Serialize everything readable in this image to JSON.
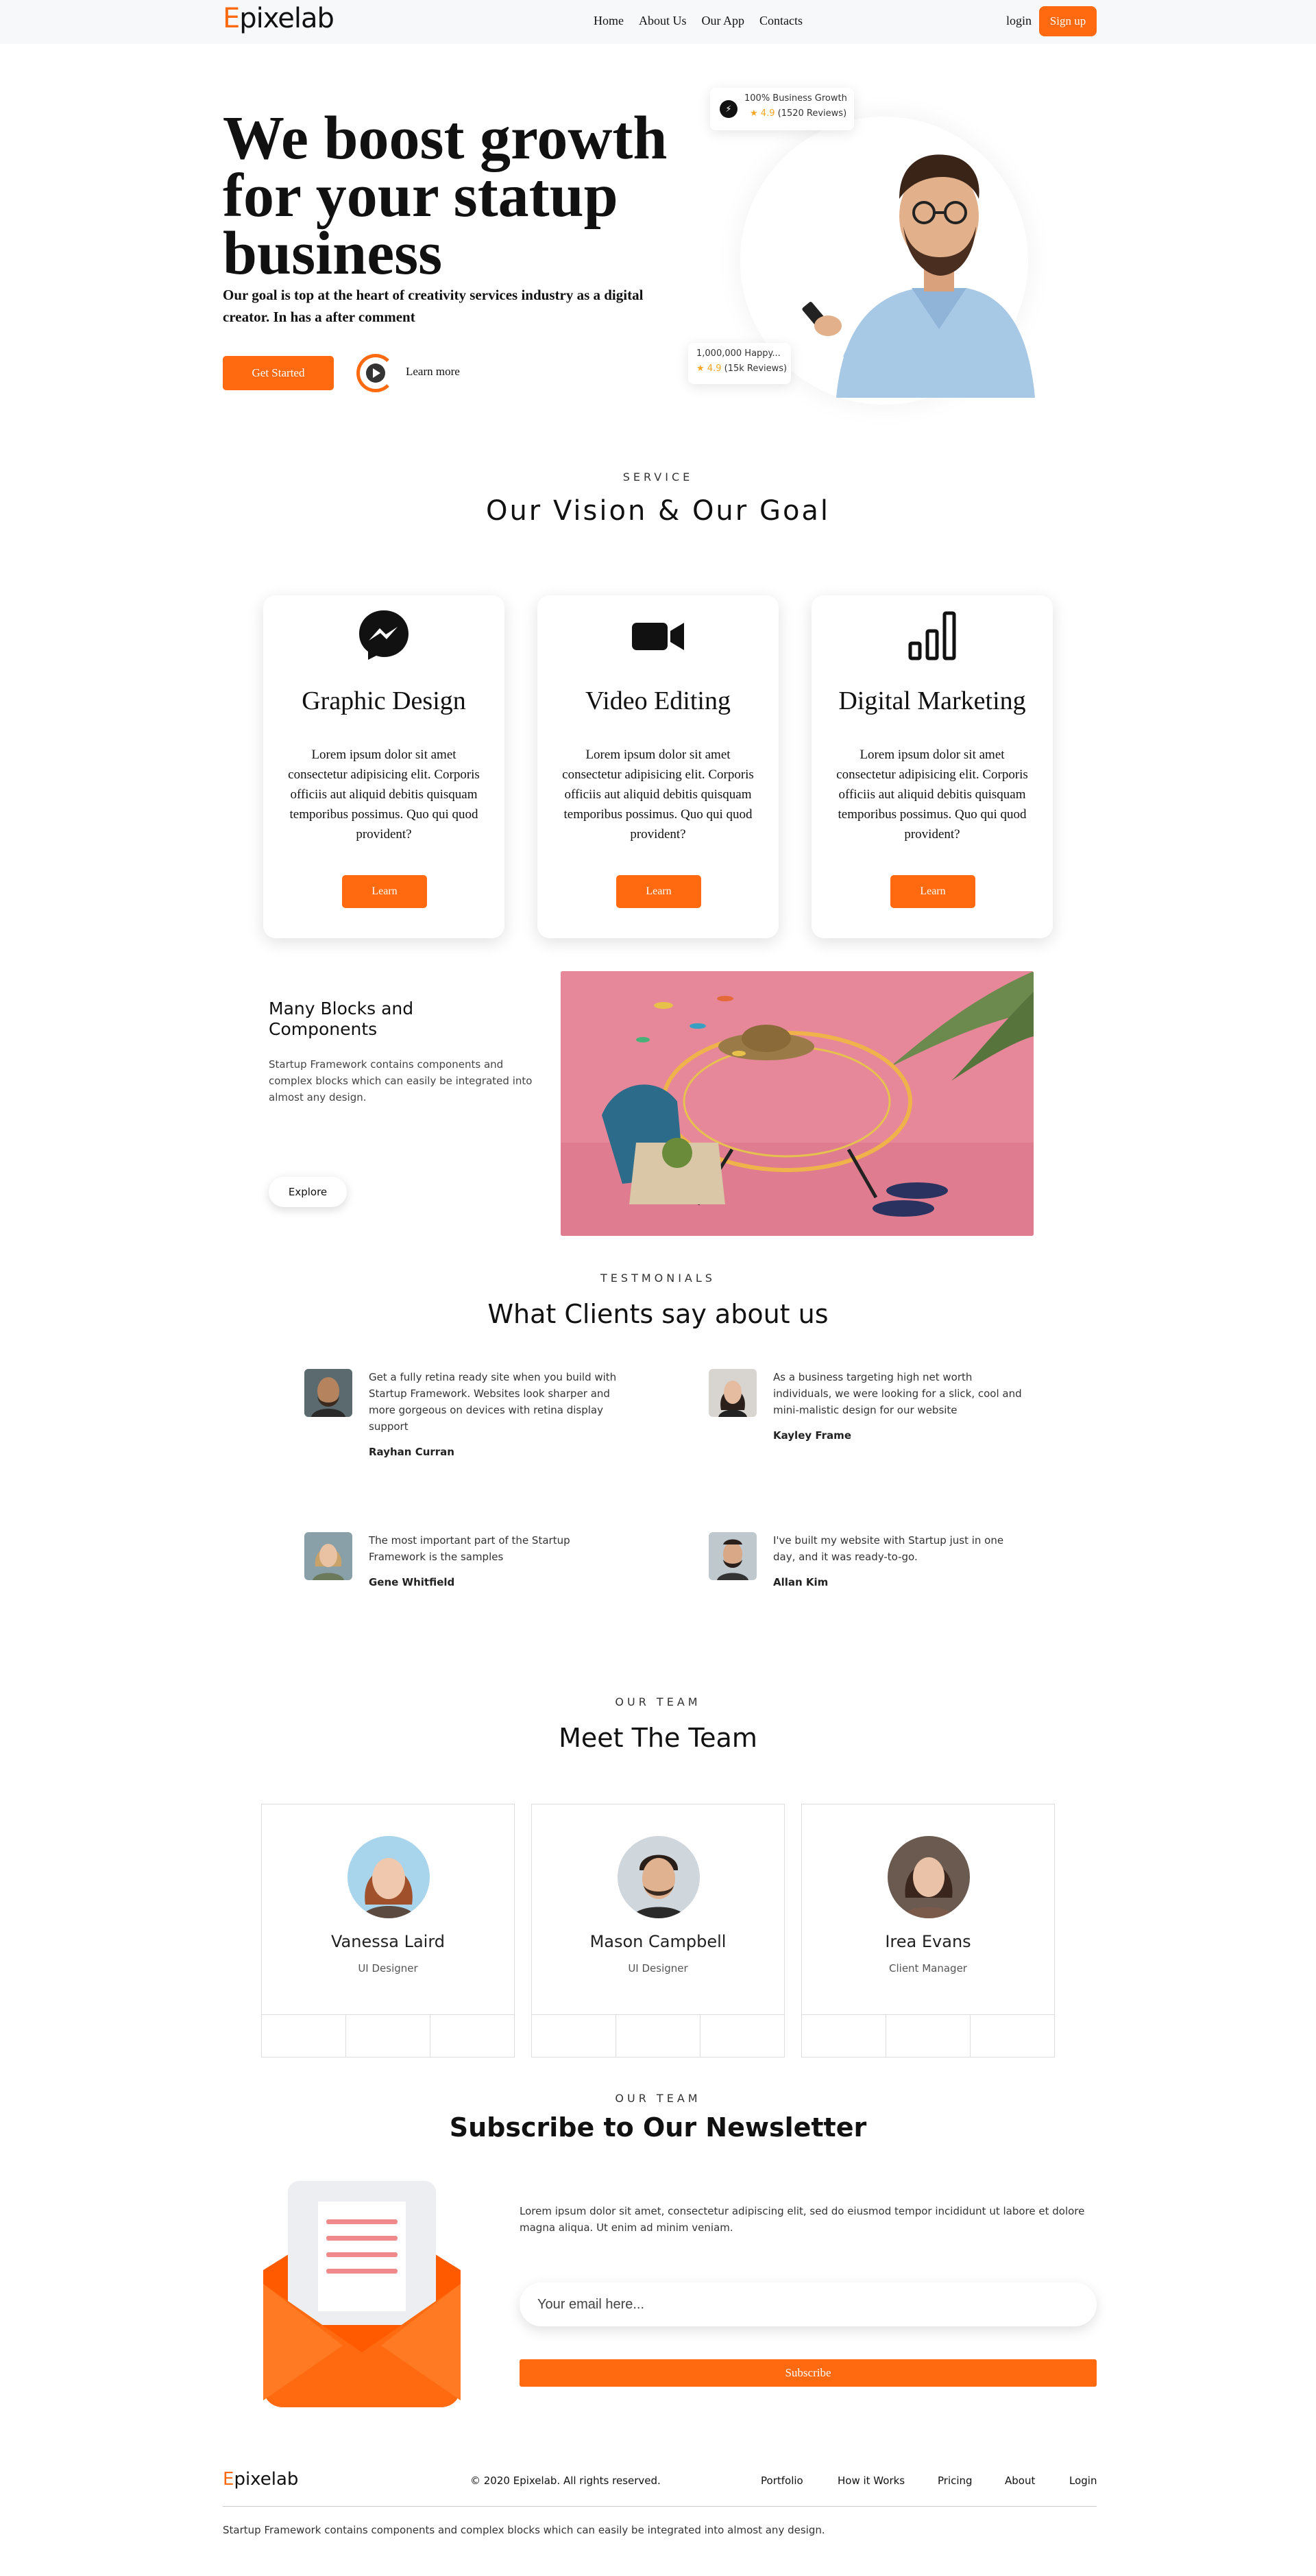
{
  "nav": {
    "logo_accent": "E",
    "logo_rest": "pixelab",
    "links": [
      "Home",
      "About Us",
      "Our App",
      "Contacts"
    ],
    "login": "login",
    "signup": "Sign up"
  },
  "hero": {
    "title": "We boost growth for your statup business",
    "subtitle": "Our goal is top at the heart of creativity services industry as a digital creator. In has a after comment",
    "cta": "Get Started",
    "learn_more": "Learn more",
    "badge_top": {
      "line1": "100% Business Growth",
      "rating": "4.9",
      "reviews": "(1520 Reviews)"
    },
    "badge_bottom": {
      "line1": "1,000,000 Happy...",
      "rating": "4.9",
      "reviews": "(15k Reviews)"
    }
  },
  "service": {
    "kicker": "SERVICE",
    "title": "Our Vision & Our Goal",
    "cards": [
      {
        "icon": "messenger-icon",
        "title": "Graphic Design",
        "text": "Lorem ipsum dolor sit amet consectetur adipisicing elit. Corporis officiis aut aliquid debitis quisquam temporibus possimus. Quo qui quod provident?",
        "button": "Learn"
      },
      {
        "icon": "video-camera-icon",
        "title": "Video Editing",
        "text": "Lorem ipsum dolor sit amet consectetur adipisicing elit. Corporis officiis aut aliquid debitis quisquam temporibus possimus. Quo qui quod provident?",
        "button": "Learn"
      },
      {
        "icon": "bar-chart-icon",
        "title": "Digital Marketing",
        "text": "Lorem ipsum dolor sit amet consectetur adipisicing elit. Corporis officiis aut aliquid debitis quisquam temporibus possimus. Quo qui quod provident?",
        "button": "Learn"
      }
    ]
  },
  "blocks": {
    "title": "Many Blocks and Components",
    "text": "Startup Framework contains components and complex blocks which can easily be integrated into almost any design.",
    "button": "Explore"
  },
  "testimonials": {
    "kicker": "TESTMONIALS",
    "title": "What Clients say about us",
    "items": [
      {
        "text": "Get a fully retina ready site when you build with Startup Framework. Websites look sharper and more gorgeous on devices with retina display support",
        "name": "Rayhan Curran"
      },
      {
        "text": "As a business targeting high net worth individuals, we were looking for a slick, cool and mini-malistic design for our website",
        "name": "Kayley Frame"
      },
      {
        "text": "The most important part of the Startup Framework is the samples",
        "name": "Gene Whitfield"
      },
      {
        "text": "I've built my website with Startup just in one day, and it was ready-to-go.",
        "name": "Allan Kim"
      }
    ]
  },
  "team": {
    "kicker": "OUR TEAM",
    "title": "Meet The Team",
    "members": [
      {
        "name": "Vanessa Laird",
        "role": "UI Designer"
      },
      {
        "name": "Mason Campbell",
        "role": "UI Designer"
      },
      {
        "name": "Irea Evans",
        "role": "Client Manager"
      }
    ]
  },
  "newsletter": {
    "kicker": "OUR TEAM",
    "title": "Subscribe to Our Newsletter",
    "text": "Lorem ipsum dolor sit amet, consectetur adipiscing elit, sed do eiusmod tempor incididunt ut labore et dolore magna aliqua. Ut enim ad minim veniam.",
    "placeholder": "Your email here...",
    "button": "Subscribe"
  },
  "footer": {
    "logo_accent": "E",
    "logo_rest": "pixelab",
    "copyright": "© 2020 Epixelab. All rights reserved.",
    "links": [
      "Portfolio",
      "How it Works",
      "Pricing",
      "About",
      "Login"
    ],
    "text": "Startup Framework contains components and complex blocks which can easily be integrated into almost any design."
  },
  "colors": {
    "accent": "#ff6a10",
    "photo_bg": "#e6879a"
  }
}
